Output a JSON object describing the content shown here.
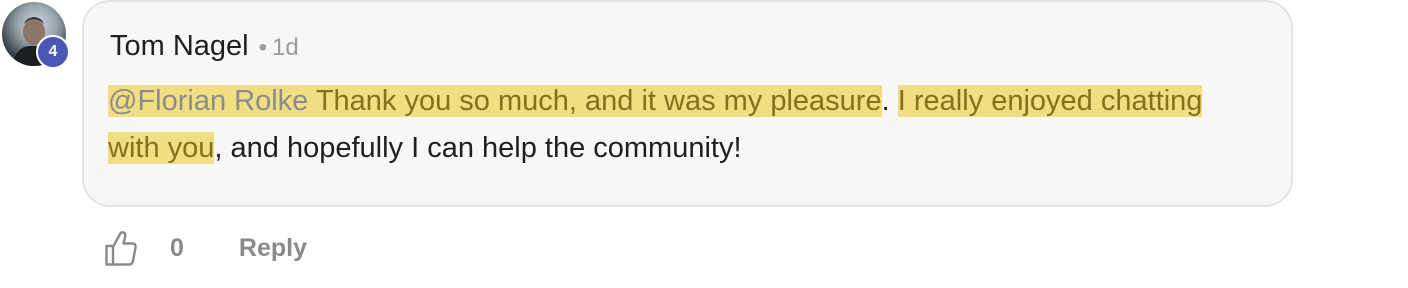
{
  "avatar": {
    "icon": "user-avatar",
    "badge": "4",
    "badge_color": "#4b56b5"
  },
  "comment": {
    "author": "Tom Nagel",
    "separator": "•",
    "time": "1d",
    "mention": "@Florian Rolke",
    "segments": [
      {
        "text": " Thank you so much, and it was my pleasure",
        "highlight": true
      },
      {
        "text": ". ",
        "highlight": false
      },
      {
        "text": "I really enjoyed chatting with you",
        "highlight": true
      },
      {
        "text": ", and hopefully I can help the community!",
        "highlight": false
      }
    ],
    "highlight_color": "#f0df82"
  },
  "actions": {
    "like_icon": "thumbs-up-icon",
    "like_count": "0",
    "reply_label": "Reply"
  }
}
